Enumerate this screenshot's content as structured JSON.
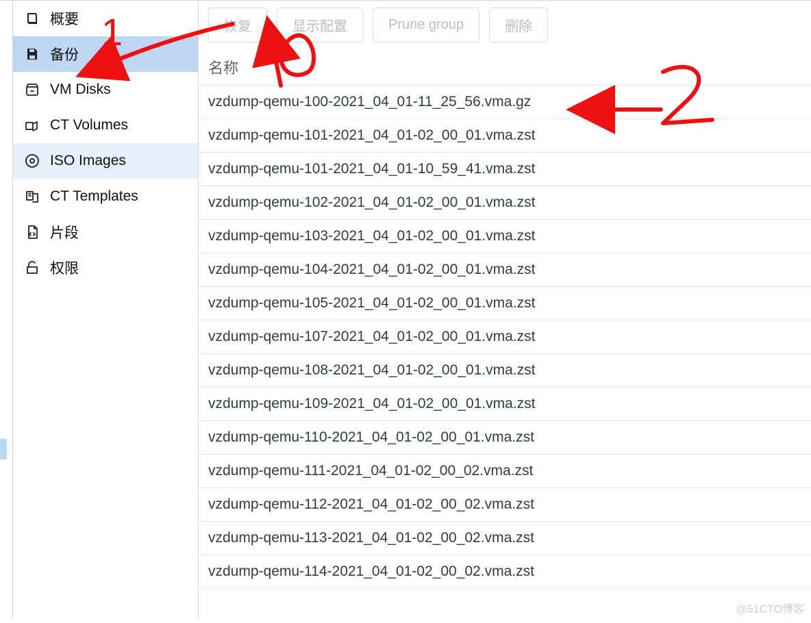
{
  "sidebar": {
    "items": [
      {
        "id": "summary",
        "label": "概要",
        "icon": "book"
      },
      {
        "id": "backup",
        "label": "备份",
        "icon": "save"
      },
      {
        "id": "vmdisks",
        "label": "VM Disks",
        "icon": "disk"
      },
      {
        "id": "ctvolumes",
        "label": "CT Volumes",
        "icon": "volumes"
      },
      {
        "id": "iso",
        "label": "ISO Images",
        "icon": "iso"
      },
      {
        "id": "cttemplates",
        "label": "CT Templates",
        "icon": "templates"
      },
      {
        "id": "snippets",
        "label": "片段",
        "icon": "code-file"
      },
      {
        "id": "perm",
        "label": "权限",
        "icon": "unlock"
      }
    ],
    "selected": "backup",
    "hover": "iso"
  },
  "toolbar": {
    "restore": "恢复",
    "showconfig": "显示配置",
    "prune": "Prune group",
    "delete": "删除"
  },
  "table": {
    "header_name": "名称",
    "rows": [
      "vzdump-qemu-100-2021_04_01-11_25_56.vma.gz",
      "vzdump-qemu-101-2021_04_01-02_00_01.vma.zst",
      "vzdump-qemu-101-2021_04_01-10_59_41.vma.zst",
      "vzdump-qemu-102-2021_04_01-02_00_01.vma.zst",
      "vzdump-qemu-103-2021_04_01-02_00_01.vma.zst",
      "vzdump-qemu-104-2021_04_01-02_00_01.vma.zst",
      "vzdump-qemu-105-2021_04_01-02_00_01.vma.zst",
      "vzdump-qemu-107-2021_04_01-02_00_01.vma.zst",
      "vzdump-qemu-108-2021_04_01-02_00_01.vma.zst",
      "vzdump-qemu-109-2021_04_01-02_00_01.vma.zst",
      "vzdump-qemu-110-2021_04_01-02_00_01.vma.zst",
      "vzdump-qemu-111-2021_04_01-02_00_02.vma.zst",
      "vzdump-qemu-112-2021_04_01-02_00_02.vma.zst",
      "vzdump-qemu-113-2021_04_01-02_00_02.vma.zst",
      "vzdump-qemu-114-2021_04_01-02_00_02.vma.zst"
    ],
    "selected_row": 0
  },
  "watermark": "@51CTO博客",
  "annotations": {
    "label1": "1",
    "label2": "2",
    "label3": "3"
  }
}
